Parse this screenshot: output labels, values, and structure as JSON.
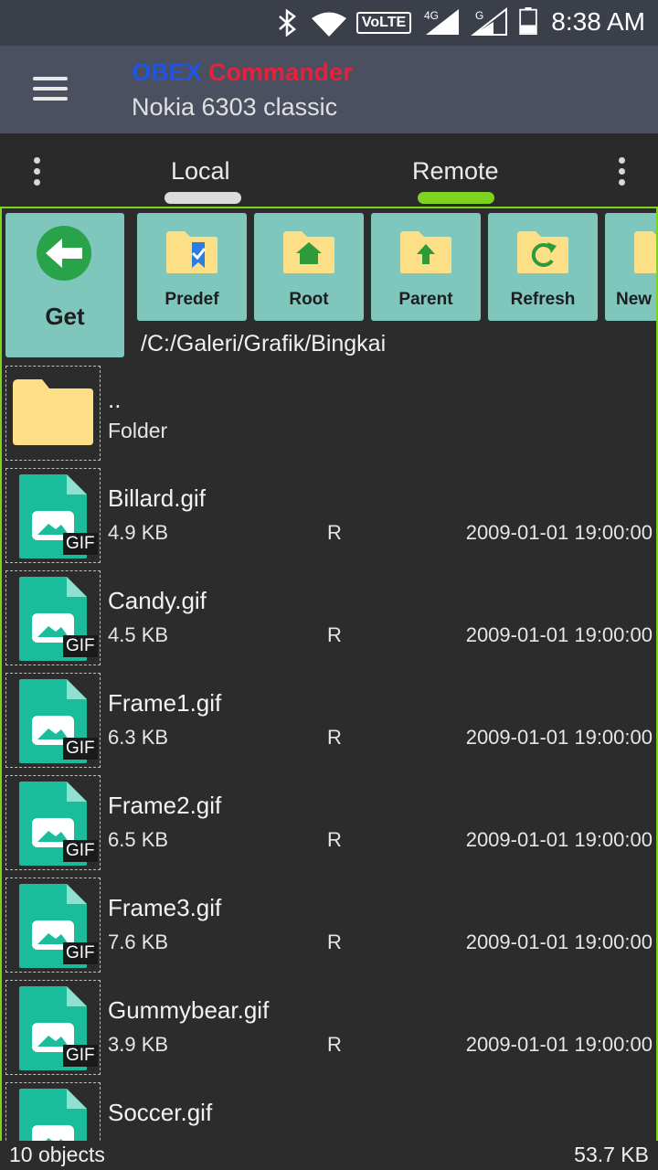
{
  "status": {
    "time": "8:38 AM",
    "volte": "VoLTE",
    "net1": "4G",
    "net2": "G",
    "icons": [
      "bluetooth-icon",
      "wifi-icon",
      "volte-icon",
      "signal-4g-icon",
      "signal-g-icon",
      "battery-icon"
    ]
  },
  "appbar": {
    "title_part1": "OBEX",
    "title_part2": "Commander",
    "subtitle": "Nokia 6303 classic"
  },
  "tabs": [
    {
      "label": "Local",
      "active": false
    },
    {
      "label": "Remote",
      "active": true
    }
  ],
  "toolbar": {
    "get_label": "Get",
    "buttons": [
      {
        "label": "Predef",
        "icon": "bookmark-folder-icon"
      },
      {
        "label": "Root",
        "icon": "home-folder-icon"
      },
      {
        "label": "Parent",
        "icon": "up-folder-icon"
      },
      {
        "label": "Refresh",
        "icon": "refresh-folder-icon"
      },
      {
        "label": "New",
        "icon": "new-folder-icon"
      }
    ]
  },
  "path": "/C:/Galeri/Grafik/Bingkai",
  "parent_entry": {
    "name": "..",
    "type": "Folder"
  },
  "files": [
    {
      "name": "Billard.gif",
      "size": "4.9 KB",
      "attr": "R",
      "date": "2009-01-01 19:00:00",
      "badge": "GIF"
    },
    {
      "name": "Candy.gif",
      "size": "4.5 KB",
      "attr": "R",
      "date": "2009-01-01 19:00:00",
      "badge": "GIF"
    },
    {
      "name": "Frame1.gif",
      "size": "6.3 KB",
      "attr": "R",
      "date": "2009-01-01 19:00:00",
      "badge": "GIF"
    },
    {
      "name": "Frame2.gif",
      "size": "6.5 KB",
      "attr": "R",
      "date": "2009-01-01 19:00:00",
      "badge": "GIF"
    },
    {
      "name": "Frame3.gif",
      "size": "7.6 KB",
      "attr": "R",
      "date": "2009-01-01 19:00:00",
      "badge": "GIF"
    },
    {
      "name": "Gummybear.gif",
      "size": "3.9 KB",
      "attr": "R",
      "date": "2009-01-01 19:00:00",
      "badge": "GIF"
    },
    {
      "name": "Soccer.gif",
      "size": "",
      "attr": "",
      "date": "",
      "badge": ""
    }
  ],
  "footer": {
    "count": "10 objects",
    "total": "53.7 KB"
  },
  "colors": {
    "accent_green": "#7ed321",
    "teal_button": "#7fc6bd",
    "folder_yellow": "#fcdf86",
    "gif_teal": "#1bbc9b",
    "brand_blue": "#1e55e8",
    "brand_red": "#e8203a"
  }
}
